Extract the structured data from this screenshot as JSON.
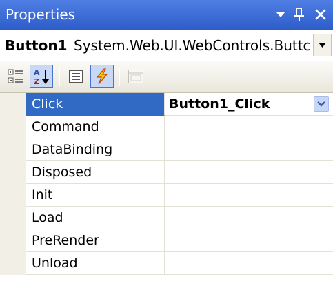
{
  "window": {
    "title": "Properties",
    "title_bar_color": "#3b6ad6"
  },
  "title_buttons": [
    {
      "name": "dropdown-arrow-icon"
    },
    {
      "name": "pin-icon"
    },
    {
      "name": "close-icon"
    }
  ],
  "object_selector": {
    "name": "Button1",
    "type": "System.Web.UI.WebControls.Buttc"
  },
  "toolbar": {
    "buttons": [
      {
        "name": "categorized-icon",
        "checked": false,
        "enabled": true
      },
      {
        "name": "alphabetical-icon",
        "checked": true,
        "enabled": true
      },
      {
        "name": "properties-icon",
        "checked": false,
        "enabled": true
      },
      {
        "name": "events-icon",
        "checked": true,
        "enabled": true
      },
      {
        "name": "property-pages-icon",
        "checked": false,
        "enabled": false
      }
    ]
  },
  "events": [
    {
      "name": "Click",
      "value": "Button1_Click",
      "selected": true
    },
    {
      "name": "Command",
      "value": ""
    },
    {
      "name": "DataBinding",
      "value": ""
    },
    {
      "name": "Disposed",
      "value": ""
    },
    {
      "name": "Init",
      "value": ""
    },
    {
      "name": "Load",
      "value": ""
    },
    {
      "name": "PreRender",
      "value": ""
    },
    {
      "name": "Unload",
      "value": ""
    }
  ],
  "colors": {
    "selection": "#316ac5",
    "toolbar_checked": "#c9d8f5"
  }
}
